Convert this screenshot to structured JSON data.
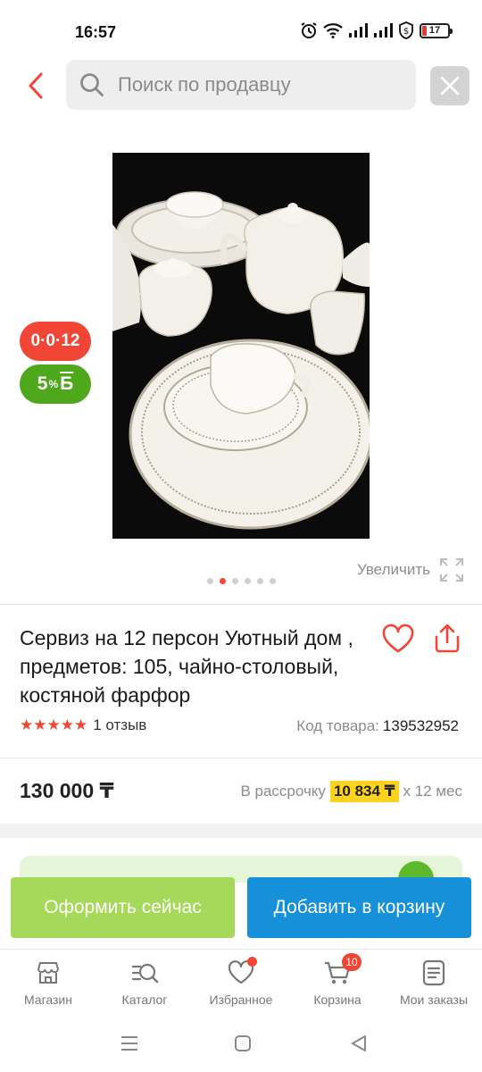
{
  "status": {
    "time": "16:57",
    "battery_level": "17",
    "icons": [
      "alarm-icon",
      "wifi-icon",
      "signal-icon",
      "signal-icon",
      "vpn-shield-icon",
      "battery-icon"
    ]
  },
  "header": {
    "search_placeholder": "Поиск по продавцу",
    "icons": [
      "back-arrow-icon",
      "search-icon",
      "close-icon"
    ]
  },
  "gallery": {
    "badge_installment": "0·0·12",
    "badge_bonus_percent": "5",
    "badge_bonus_percent_sign": "%",
    "badge_bonus_symbol": "Б",
    "zoom_label": "Увеличить",
    "dots_total": 6,
    "active_dot": 2
  },
  "product": {
    "title": "Сервиз на 12 персон Уютный дом , предметов: 105, чайно-столовый, костяной фарфор",
    "rating_stars": 5,
    "reviews": "1 отзыв",
    "sku_label": "Код товара:",
    "sku_value": "139532952",
    "price": "130 000 ₸",
    "installment_prefix": "В рассрочку",
    "installment_amount": "10 834 ₸",
    "installment_suffix": "х 12 мес"
  },
  "actions": {
    "buy_now": "Оформить сейчас",
    "add_to_cart": "Добавить в корзину"
  },
  "nav": {
    "items": [
      {
        "label": "Магазин",
        "icon": "store-icon"
      },
      {
        "label": "Каталог",
        "icon": "catalog-search-icon"
      },
      {
        "label": "Избранное",
        "icon": "heart-icon"
      },
      {
        "label": "Корзина",
        "icon": "cart-icon"
      },
      {
        "label": "Мои заказы",
        "icon": "orders-icon"
      }
    ],
    "cart_count": "10"
  },
  "colors": {
    "accent_red": "#f14635",
    "bonus_green": "#4fa81c",
    "buy_now_green": "#a6d95a",
    "add_cart_blue": "#1690d8",
    "installment_yellow": "#ffd21e"
  }
}
